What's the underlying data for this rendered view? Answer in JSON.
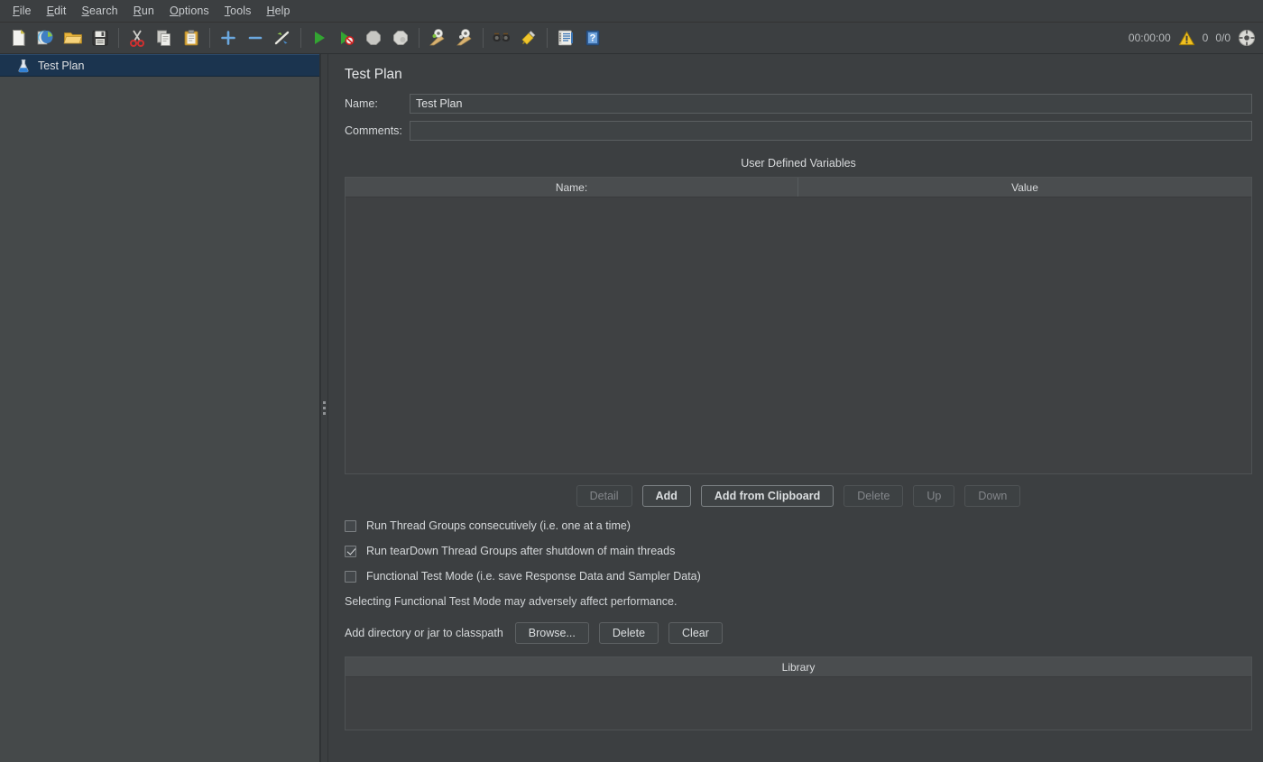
{
  "menubar": {
    "items": [
      {
        "label": "File",
        "mnemonic": "F"
      },
      {
        "label": "Edit",
        "mnemonic": "E"
      },
      {
        "label": "Search",
        "mnemonic": "S"
      },
      {
        "label": "Run",
        "mnemonic": "R"
      },
      {
        "label": "Options",
        "mnemonic": "O"
      },
      {
        "label": "Tools",
        "mnemonic": "T"
      },
      {
        "label": "Help",
        "mnemonic": "H"
      }
    ]
  },
  "toolbar": {
    "icons": [
      "new-document-icon",
      "templates-icon",
      "open-folder-icon",
      "save-icon",
      "cut-icon",
      "copy-icon",
      "paste-icon",
      "expand-all-icon",
      "collapse-all-icon",
      "toggle-icon",
      "start-icon",
      "start-no-pauses-icon",
      "stop-icon",
      "shutdown-icon",
      "clear-icon",
      "clear-all-icon",
      "search-icon",
      "search-reset-icon",
      "function-helper-icon",
      "help-icon"
    ],
    "status": {
      "elapsed_time": "00:00:00",
      "warning_count": "0",
      "threads": "0/0",
      "warning_icon": "warning-triangle-icon",
      "remote_icon": "remote-connection-icon"
    }
  },
  "tree": {
    "items": [
      {
        "label": "Test Plan",
        "icon": "test-plan-flask-icon",
        "selected": true
      }
    ]
  },
  "main": {
    "title": "Test Plan",
    "name_label": "Name:",
    "name_value": "Test Plan",
    "comments_label": "Comments:",
    "comments_value": "",
    "comments_placeholder": "",
    "udv_section_title": "User Defined Variables",
    "udv_columns": [
      "Name:",
      "Value"
    ],
    "udv_rows": [],
    "udv_buttons": [
      {
        "label": "Detail",
        "enabled": false
      },
      {
        "label": "Add",
        "enabled": true
      },
      {
        "label": "Add from Clipboard",
        "enabled": true
      },
      {
        "label": "Delete",
        "enabled": false
      },
      {
        "label": "Up",
        "enabled": false
      },
      {
        "label": "Down",
        "enabled": false
      }
    ],
    "checkboxes": [
      {
        "label": "Run Thread Groups consecutively (i.e. one at a time)",
        "checked": false
      },
      {
        "label": "Run tearDown Thread Groups after shutdown of main threads",
        "checked": true
      },
      {
        "label": "Functional Test Mode (i.e. save Response Data and Sampler Data)",
        "checked": false
      }
    ],
    "functional_note": "Selecting Functional Test Mode may adversely affect performance.",
    "classpath_label": "Add directory or jar to classpath",
    "classpath_buttons": [
      {
        "label": "Browse...",
        "enabled": true
      },
      {
        "label": "Delete",
        "enabled": true
      },
      {
        "label": "Clear",
        "enabled": true
      }
    ],
    "library_column": "Library",
    "library_rows": []
  },
  "colors": {
    "window_bg": "#3c3f41",
    "tree_bg": "#45494a",
    "selection_blue": "#1b344f",
    "table_header": "#4a4d4f",
    "table_body": "#3f4143",
    "text": "#d9dbdd",
    "disabled_text": "#83868a",
    "warning_yellow": "#f0c020"
  }
}
